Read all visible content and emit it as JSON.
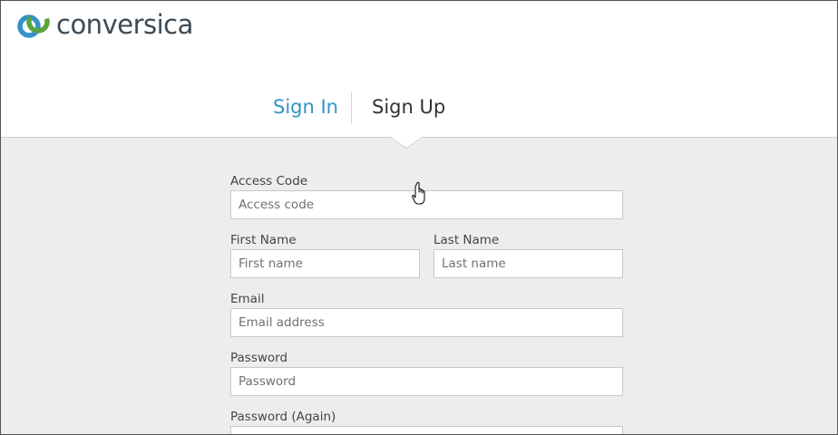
{
  "brand": {
    "name": "conversica",
    "logo_colors": [
      "#3592c9",
      "#5aa53f"
    ]
  },
  "tabs": {
    "sign_in": "Sign In",
    "sign_up": "Sign Up",
    "active": "Sign Up"
  },
  "form": {
    "access_code": {
      "label": "Access Code",
      "placeholder": "Access code",
      "value": ""
    },
    "first_name": {
      "label": "First Name",
      "placeholder": "First name",
      "value": ""
    },
    "last_name": {
      "label": "Last Name",
      "placeholder": "Last name",
      "value": ""
    },
    "email": {
      "label": "Email",
      "placeholder": "Email address",
      "value": ""
    },
    "password": {
      "label": "Password",
      "placeholder": "Password",
      "value": ""
    },
    "password_again": {
      "label": "Password (Again)",
      "placeholder": "",
      "value": ""
    }
  },
  "colors": {
    "accent": "#3592c9",
    "background": "#ededed",
    "text": "#333333"
  },
  "cursor": {
    "type": "hand-pointer-icon"
  }
}
